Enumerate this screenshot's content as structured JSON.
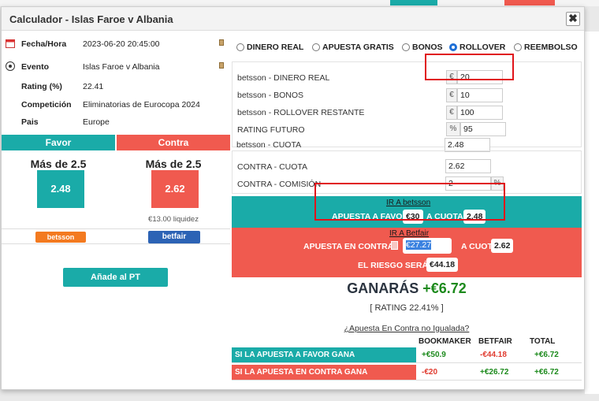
{
  "modal": {
    "title": "Calculador - Islas Faroe v Albania",
    "close": "✖"
  },
  "info": [
    {
      "label": "Fecha/Hora",
      "value": "2023-06-20 20:45:00",
      "icon": "calendar-icon"
    },
    {
      "label": "Evento",
      "value": "Islas Faroe v Albania",
      "icon": "soccer-ball-icon"
    },
    {
      "label": "Rating (%)",
      "value": "22.41",
      "icon": ""
    },
    {
      "label": "Competición",
      "value": "Eliminatorias de Eurocopa 2024",
      "icon": ""
    },
    {
      "label": "Pais",
      "value": "Europe",
      "icon": ""
    }
  ],
  "favor": {
    "header": "Favor",
    "market": "Más de 2.5",
    "odds": "2.48",
    "bookmaker": "betsson"
  },
  "contra": {
    "header": "Contra",
    "market": "Más de 2.5",
    "odds": "2.62",
    "liquidity": "€13.00 liquidez",
    "exchange": "betfair"
  },
  "add_pt": "Añade al PT",
  "modes": [
    {
      "label": "DINERO REAL",
      "selected": false
    },
    {
      "label": "APUESTA GRATIS",
      "selected": false
    },
    {
      "label": "BONOS",
      "selected": false
    },
    {
      "label": "ROLLOVER",
      "selected": true
    },
    {
      "label": "REEMBOLSO",
      "selected": false
    }
  ],
  "fields": {
    "dinero_real": {
      "label": "betsson - DINERO REAL",
      "prefix": "€",
      "value": "20"
    },
    "bonos": {
      "label": "betsson - BONOS",
      "prefix": "€",
      "value": "10"
    },
    "rollover": {
      "label": "betsson - ROLLOVER RESTANTE",
      "prefix": "€",
      "value": "100"
    },
    "rating_futuro": {
      "label": "RATING FUTURO",
      "prefix": "%",
      "value": "95"
    },
    "cuota": {
      "label": "betsson - CUOTA",
      "value": "2.48"
    },
    "contra_cuota": {
      "label": "CONTRA - CUOTA",
      "value": "2.62"
    },
    "contra_comision": {
      "label": "CONTRA - COMISIÓN",
      "value": "2",
      "suffix": "%"
    }
  },
  "favor_band": {
    "link": "IR A betsson",
    "label": "APUESTA A FAVOR",
    "stake": "€30",
    "cuota_label": "A CUOTA",
    "cuota": "2.48"
  },
  "contra_band": {
    "link": "IR A Betfair",
    "label": "APUESTA EN CONTRA",
    "stake": "€27.27",
    "cuota_label": "A CUOTA",
    "cuota": "2.62",
    "risk_label": "EL RIESGO SERÁ",
    "risk": "€44.18"
  },
  "result": {
    "label": "GANARÁS",
    "value": "+€6.72",
    "rating": "[ RATING 22.41% ]",
    "unmatched_link": "¿Apuesta En Contra no Igualada?"
  },
  "table": {
    "headers": [
      "BOOKMAKER",
      "BETFAIR",
      "TOTAL"
    ],
    "rows": [
      {
        "label": "SI LA APUESTA A FAVOR GANA",
        "bookmaker": "+€50.9",
        "betfair": "-€44.18",
        "total": "+€6.72"
      },
      {
        "label": "SI LA APUESTA EN CONTRA GANA",
        "bookmaker": "-€20",
        "betfair": "+€26.72",
        "total": "+€6.72"
      }
    ]
  },
  "colors": {
    "favor": "#1aaba8",
    "contra": "#f05a4f",
    "highlight": "#e0141a"
  }
}
